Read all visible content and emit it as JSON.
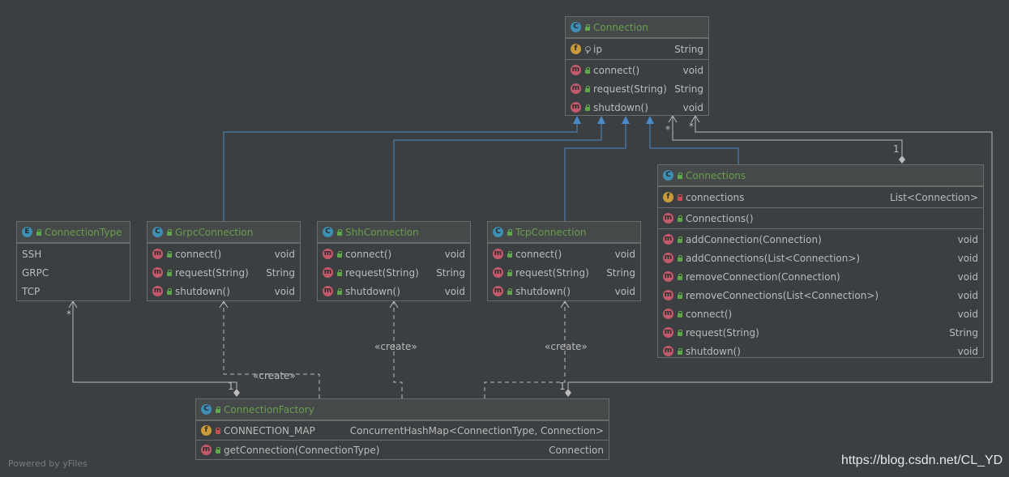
{
  "classes": {
    "connection": {
      "name": "Connection",
      "fields": [
        {
          "name": "ip",
          "type": "String"
        }
      ],
      "methods": [
        {
          "name": "connect()",
          "type": "void"
        },
        {
          "name": "request(String)",
          "type": "String"
        },
        {
          "name": "shutdown()",
          "type": "void"
        }
      ]
    },
    "connection_type": {
      "name": "ConnectionType",
      "constants": [
        "SSH",
        "GRPC",
        "TCP"
      ]
    },
    "grpc": {
      "name": "GrpcConnection",
      "methods": [
        {
          "name": "connect()",
          "type": "void"
        },
        {
          "name": "request(String)",
          "type": "String"
        },
        {
          "name": "shutdown()",
          "type": "void"
        }
      ]
    },
    "shh": {
      "name": "ShhConnection",
      "methods": [
        {
          "name": "connect()",
          "type": "void"
        },
        {
          "name": "request(String)",
          "type": "String"
        },
        {
          "name": "shutdown()",
          "type": "void"
        }
      ]
    },
    "tcp": {
      "name": "TcpConnection",
      "methods": [
        {
          "name": "connect()",
          "type": "void"
        },
        {
          "name": "request(String)",
          "type": "String"
        },
        {
          "name": "shutdown()",
          "type": "void"
        }
      ]
    },
    "connections": {
      "name": "Connections",
      "fields": [
        {
          "name": "connections",
          "type": "List<Connection>"
        }
      ],
      "constructors": [
        {
          "name": "Connections()"
        }
      ],
      "methods": [
        {
          "name": "addConnection(Connection)",
          "type": "void"
        },
        {
          "name": "addConnections(List<Connection>)",
          "type": "void"
        },
        {
          "name": "removeConnection(Connection)",
          "type": "void"
        },
        {
          "name": "removeConnections(List<Connection>)",
          "type": "void"
        },
        {
          "name": "connect()",
          "type": "void"
        },
        {
          "name": "request(String)",
          "type": "String"
        },
        {
          "name": "shutdown()",
          "type": "void"
        }
      ]
    },
    "factory": {
      "name": "ConnectionFactory",
      "fields": [
        {
          "name": "CONNECTION_MAP",
          "type": "ConcurrentHashMap<ConnectionType, Connection>"
        }
      ],
      "methods": [
        {
          "name": "getConnection(ConnectionType)",
          "type": "Connection"
        }
      ]
    }
  },
  "icons": {
    "class": "C",
    "enum": "E",
    "method": "m",
    "field": "f"
  },
  "edge_labels": {
    "create": "«create»",
    "star": "*",
    "one": "1"
  },
  "footer": {
    "left": "Powered by yFiles",
    "right": "https://blog.csdn.net/CL_YD"
  },
  "colors": {
    "background": "#3c3f41",
    "class_name": "#6a9d4c",
    "inheritance_edge": "#4a88c7",
    "dependency_edge": "#bbbbbb"
  }
}
